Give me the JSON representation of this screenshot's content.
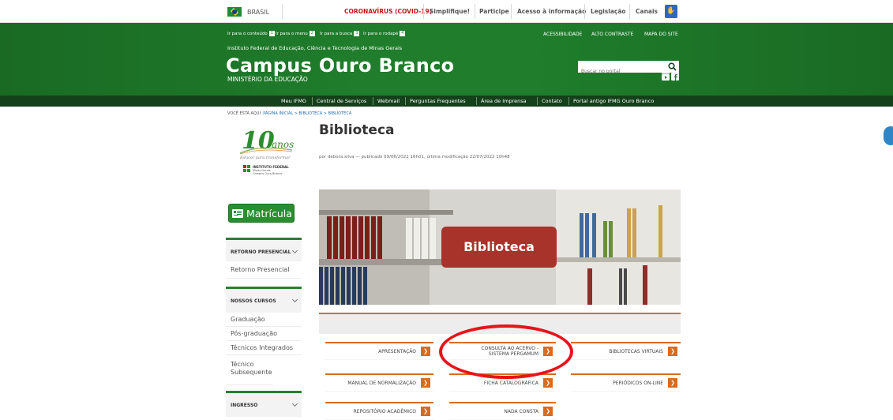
{
  "gov_bar": {
    "country": "BRASIL",
    "links": [
      "CORONAVÍRUS (COVID-19)",
      "Simplifique!",
      "Participe",
      "Acesso à informação",
      "Legislação",
      "Canais"
    ]
  },
  "header": {
    "skip_links": [
      {
        "label": "Ir para o conteúdo",
        "key": "1"
      },
      {
        "label": "Ir para o menu",
        "key": "2"
      },
      {
        "label": "Ir para a busca",
        "key": "3"
      },
      {
        "label": "Ir para o rodapé",
        "key": "4"
      }
    ],
    "top_links": [
      "ACESSIBILIDADE",
      "ALTO CONTRASTE",
      "MAPA DO SITE"
    ],
    "institution": "Instituto Federal de Educação, Ciência e Tecnologia de Minas Gerais",
    "site_title": "Campus Ouro Branco",
    "ministry": "MINISTÉRIO DA EDUCAÇÃO",
    "search_placeholder": "Buscar no portal"
  },
  "nav": [
    "Meu IFMG",
    "Central de Serviços",
    "Webmail",
    "Perguntas Frequentes",
    "Área de Imprensa",
    "Contato",
    "Portal antigo IFMG Ouro Branco"
  ],
  "breadcrumb": {
    "prefix": "VOCÊ ESTÁ AQUI:",
    "path": "PÁGINA INICIAL > BIBLIOTECA > BIBLIOTECA"
  },
  "sidebar": {
    "logo": {
      "number": "10",
      "word": "anos",
      "tagline": "Educar para transformar",
      "inst": "INSTITUTO FEDERAL",
      "sub1": "Minas Gerais",
      "sub2": "Campus Ouro Branco"
    },
    "matricula_label": "Matrícula",
    "sections": [
      {
        "heading": "RETORNO PRESENCIAL",
        "items": [
          "Retorno Presencial"
        ]
      },
      {
        "heading": "NOSSOS CURSOS",
        "items": [
          "Graduação",
          "Pós-graduação",
          "Técnicos Integrados",
          "Técnico Subsequente"
        ]
      },
      {
        "heading": "INGRESSO",
        "items": []
      }
    ]
  },
  "main": {
    "title": "Biblioteca",
    "byline": "por debora.silva — publicado 09/06/2022 16h01, última modificação 22/07/2022 10h48",
    "banner_label": "Biblioteca",
    "links": [
      {
        "label": "APRESENTAÇÃO"
      },
      {
        "label": "CONSULTA AO ACERVO - SISTEMA PERGAMUM"
      },
      {
        "label": "BIBLIOTECAS VIRTUAIS"
      },
      {
        "label": "MANUAL DE NORMALIZAÇÃO"
      },
      {
        "label": "FICHA CATALOGRÁFICA"
      },
      {
        "label": "PERIÓDICOS ON-LINE"
      },
      {
        "label": "REPOSITÓRIO ACADÊMICO"
      },
      {
        "label": "NADA CONSTA"
      }
    ]
  },
  "colors": {
    "green": "#1f7d2b",
    "dark_green": "#14401a",
    "orange": "#d96b1f",
    "highlight": "#e6141b"
  }
}
